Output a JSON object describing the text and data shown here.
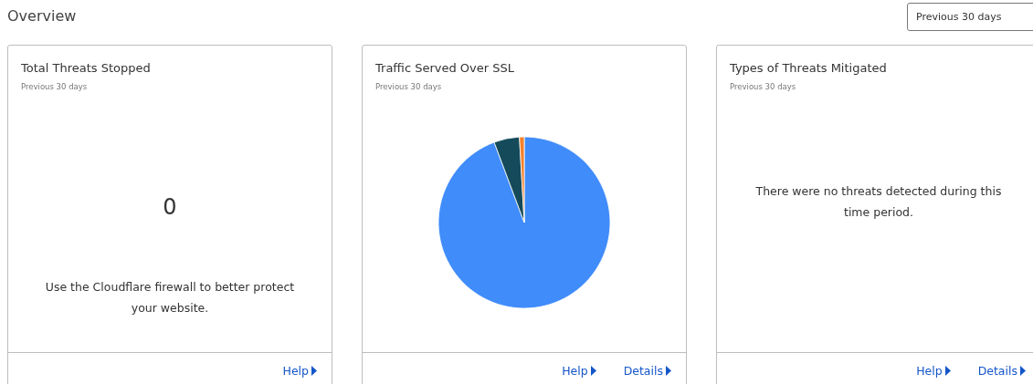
{
  "header": {
    "title": "Overview",
    "period_select": {
      "value": "Previous 30 days"
    }
  },
  "cards": [
    {
      "kind": "number",
      "title": "Total Threats Stopped",
      "subtitle": "Previous 30 days",
      "value": "0",
      "message": "Use the Cloudflare firewall to better protect your website.",
      "links": [
        "Help"
      ]
    },
    {
      "kind": "pie",
      "title": "Traffic Served Over SSL",
      "subtitle": "Previous 30 days",
      "links": [
        "Help",
        "Details"
      ]
    },
    {
      "kind": "message",
      "title": "Types of Threats Mitigated",
      "subtitle": "Previous 30 days",
      "message": "There were no threats detected during this time period.",
      "links": [
        "Help",
        "Details"
      ]
    }
  ]
}
